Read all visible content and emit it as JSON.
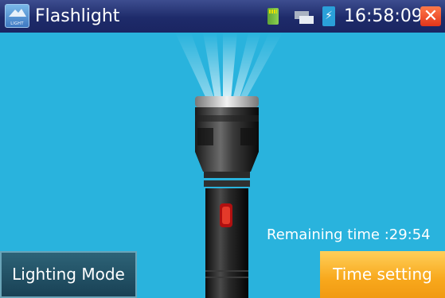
{
  "titlebar": {
    "title": "Flashlight",
    "app_icon_text": "LIGHT",
    "time": "16:58:09",
    "battery_glyph": "⚡",
    "close_glyph": "✕"
  },
  "main": {
    "remaining": "Remaining time :29:54"
  },
  "buttons": {
    "lighting_mode": "Lighting Mode",
    "time_setting": "Time setting"
  },
  "colors": {
    "background": "#29b3dd",
    "titlebar": "#1e2b6a",
    "accent_orange": "#f8a81c",
    "close_red": "#e2341a"
  }
}
